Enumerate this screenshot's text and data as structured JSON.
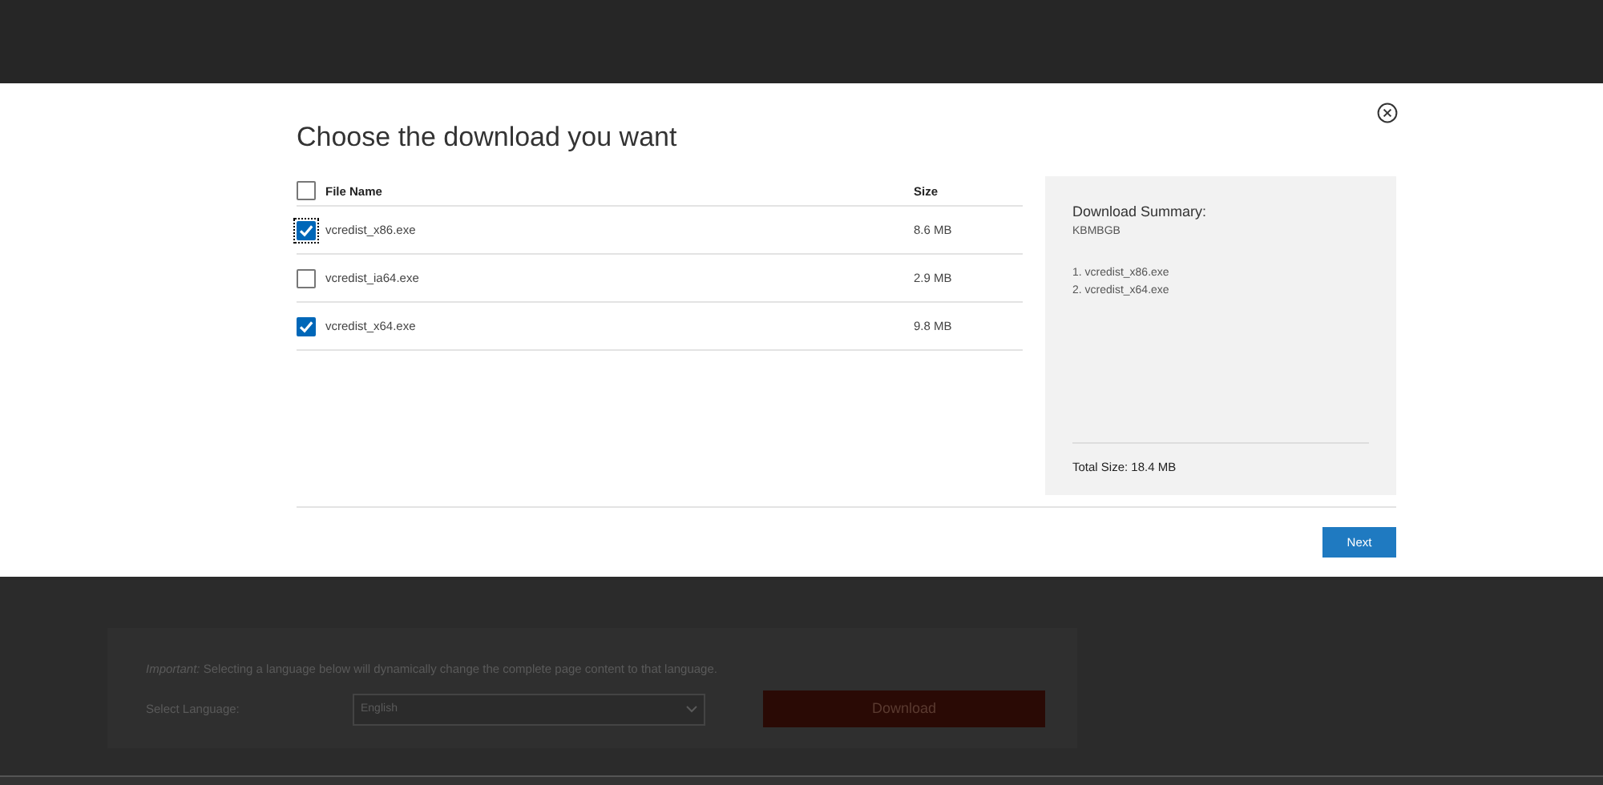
{
  "dialog": {
    "title": "Choose the download you want",
    "select_all": {
      "checked": false
    },
    "columns": [
      "File Name",
      "Size"
    ],
    "files": [
      {
        "name": "vcredist_x86.exe",
        "size": "8.6 MB",
        "checked": true,
        "focused": true
      },
      {
        "name": "vcredist_ia64.exe",
        "size": "2.9 MB",
        "checked": false,
        "focused": false
      },
      {
        "name": "vcredist_x64.exe",
        "size": "9.8 MB",
        "checked": true,
        "focused": false
      }
    ],
    "summary": {
      "heading": "Download Summary:",
      "code": "KBMBGB",
      "items": [
        "1. vcredist_x86.exe",
        "2. vcredist_x64.exe"
      ],
      "total": "Total Size: 18.4 MB"
    },
    "next_button": "Next"
  },
  "background_page": {
    "notice": "*Important:* Selecting a language below will dynamically change the complete page content to that language.",
    "language_label": "Select Language:",
    "language": "English",
    "download_button": "Download"
  }
}
